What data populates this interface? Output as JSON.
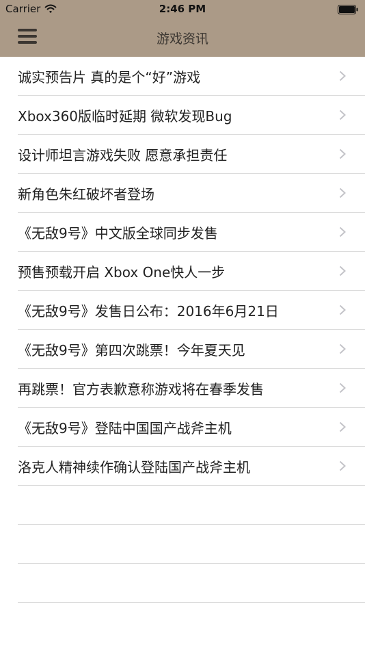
{
  "status_bar": {
    "carrier": "Carrier",
    "time": "2:46 PM"
  },
  "navbar": {
    "title": "游戏资讯",
    "background": "#ab9a87"
  },
  "news": [
    {
      "title": "诚实预告片 真的是个“好”游戏"
    },
    {
      "title": "Xbox360版临时延期 微软发现Bug"
    },
    {
      "title": "设计师坦言游戏失败 愿意承担责任"
    },
    {
      "title": "新角色朱红破坏者登场"
    },
    {
      "title": "《无敌9号》中文版全球同步发售"
    },
    {
      "title": "预售预载开启 Xbox One快人一步"
    },
    {
      "title": "《无敌9号》发售日公布：2016年6月21日"
    },
    {
      "title": "《无敌9号》第四次跳票！今年夏天见"
    },
    {
      "title": "再跳票！官方表歉意称游戏将在春季发售"
    },
    {
      "title": "《无敌9号》登陆中国国产战斧主机"
    },
    {
      "title": "洛克人精神续作确认登陆国产战斧主机"
    }
  ]
}
